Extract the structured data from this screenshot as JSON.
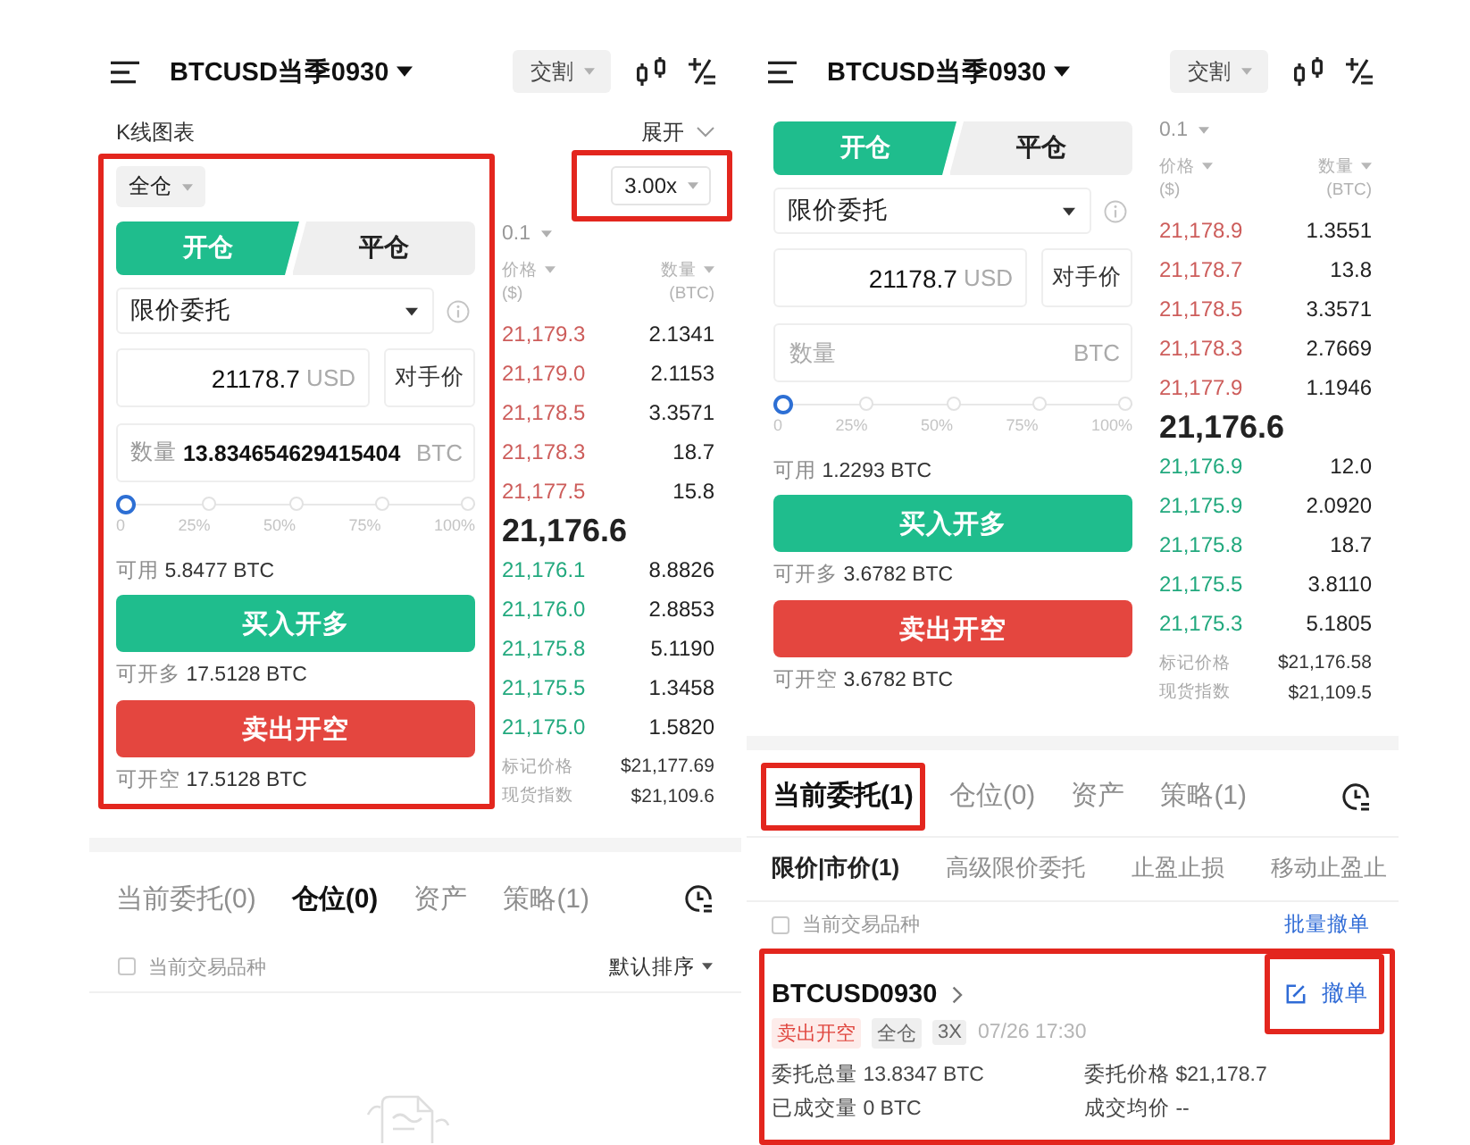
{
  "panels": [
    {
      "header": {
        "title": "BTCUSD当季0930",
        "contract_type": "交割"
      },
      "chart_bar": {
        "label": "K线图表",
        "toggle": "展开"
      },
      "form": {
        "highlighted": true,
        "margin_mode": "全仓",
        "tabs": [
          {
            "label": "开仓",
            "selected": true
          },
          {
            "label": "平仓",
            "selected": false
          }
        ],
        "order_type": "限价委托",
        "price": {
          "value": "21178.7",
          "unit": "USD"
        },
        "counter_price_button": "对手价",
        "quantity": {
          "label": "数量",
          "value": "13.834654629415404",
          "unit": "BTC"
        },
        "slider": {
          "level": 0,
          "ticks": [
            "0",
            "25%",
            "50%",
            "75%",
            "100%"
          ]
        },
        "available": {
          "label": "可用",
          "value": "5.8477 BTC"
        },
        "buy_button": "买入开多",
        "max_long": {
          "label": "可开多",
          "value": "17.5128 BTC"
        },
        "sell_button": "卖出开空",
        "max_short": {
          "label": "可开空",
          "value": "17.5128 BTC"
        }
      },
      "order_book": {
        "leverage": {
          "value": "3.00x",
          "highlighted": true
        },
        "precision": "0.1",
        "price_header": {
          "label": "价格",
          "unit": "($)"
        },
        "amount_header": {
          "label": "数量",
          "unit": "(BTC)"
        },
        "asks": [
          {
            "price": "21,179.3",
            "amount": "2.1341"
          },
          {
            "price": "21,179.0",
            "amount": "2.1153"
          },
          {
            "price": "21,178.5",
            "amount": "3.3571"
          },
          {
            "price": "21,178.3",
            "amount": "18.7"
          },
          {
            "price": "21,177.5",
            "amount": "15.8"
          }
        ],
        "last_price": "21,176.6",
        "bids": [
          {
            "price": "21,176.1",
            "amount": "8.8826"
          },
          {
            "price": "21,176.0",
            "amount": "2.8853"
          },
          {
            "price": "21,175.8",
            "amount": "5.1190"
          },
          {
            "price": "21,175.5",
            "amount": "1.3458"
          },
          {
            "price": "21,175.0",
            "amount": "1.5820"
          }
        ],
        "mark_price": {
          "label": "标记价格",
          "value": "$21,177.69"
        },
        "index_price": {
          "label": "现货指数",
          "value": "$21,109.6"
        }
      },
      "orders": {
        "tabs": [
          {
            "label": "当前委托(0)",
            "selected": false,
            "highlighted": false
          },
          {
            "label": "仓位(0)",
            "selected": true,
            "highlighted": false
          },
          {
            "label": "资产",
            "selected": false,
            "highlighted": false
          },
          {
            "label": "策略(1)",
            "selected": false,
            "highlighted": false
          }
        ],
        "filter": {
          "label": "当前交易品种",
          "checked": false
        },
        "sort": "默认排序"
      }
    },
    {
      "header": {
        "title": "BTCUSD当季0930",
        "contract_type": "交割"
      },
      "form": {
        "highlighted": false,
        "tabs": [
          {
            "label": "开仓",
            "selected": true
          },
          {
            "label": "平仓",
            "selected": false
          }
        ],
        "order_type": "限价委托",
        "price": {
          "value": "21178.7",
          "unit": "USD"
        },
        "counter_price_button": "对手价",
        "quantity": {
          "placeholder": "数量",
          "unit": "BTC"
        },
        "slider": {
          "level": 0,
          "ticks": [
            "0",
            "25%",
            "50%",
            "75%",
            "100%"
          ]
        },
        "available": {
          "label": "可用",
          "value": "1.2293 BTC"
        },
        "buy_button": "买入开多",
        "max_long": {
          "label": "可开多",
          "value": "3.6782 BTC"
        },
        "sell_button": "卖出开空",
        "max_short": {
          "label": "可开空",
          "value": "3.6782 BTC"
        }
      },
      "order_book": {
        "precision": "0.1",
        "price_header": {
          "label": "价格",
          "unit": "($)"
        },
        "amount_header": {
          "label": "数量",
          "unit": "(BTC)"
        },
        "asks": [
          {
            "price": "21,178.9",
            "amount": "1.3551"
          },
          {
            "price": "21,178.7",
            "amount": "13.8"
          },
          {
            "price": "21,178.5",
            "amount": "3.3571"
          },
          {
            "price": "21,178.3",
            "amount": "2.7669"
          },
          {
            "price": "21,177.9",
            "amount": "1.1946"
          }
        ],
        "last_price": "21,176.6",
        "bids": [
          {
            "price": "21,176.9",
            "amount": "12.0"
          },
          {
            "price": "21,175.9",
            "amount": "2.0920"
          },
          {
            "price": "21,175.8",
            "amount": "18.7"
          },
          {
            "price": "21,175.5",
            "amount": "3.8110"
          },
          {
            "price": "21,175.3",
            "amount": "5.1805"
          }
        ],
        "mark_price": {
          "label": "标记价格",
          "value": "$21,176.58"
        },
        "index_price": {
          "label": "现货指数",
          "value": "$21,109.5"
        }
      },
      "orders": {
        "tabs": [
          {
            "label": "当前委托(1)",
            "selected": true,
            "highlighted": true
          },
          {
            "label": "仓位(0)",
            "selected": false,
            "highlighted": false
          },
          {
            "label": "资产",
            "selected": false,
            "highlighted": false
          },
          {
            "label": "策略(1)",
            "selected": false,
            "highlighted": false
          }
        ],
        "sub_tabs": [
          {
            "label": "限价|市价(1)",
            "selected": true
          },
          {
            "label": "高级限价委托",
            "selected": false
          },
          {
            "label": "止盈止损",
            "selected": false
          },
          {
            "label": "移动止盈止",
            "selected": false
          }
        ],
        "filter": {
          "label": "当前交易品种",
          "checked": false
        },
        "batch_cancel": "批量撤单",
        "list": [
          {
            "highlighted": true,
            "symbol": "BTCUSD0930",
            "actions_highlighted": true,
            "cancel": "撤单",
            "tags": [
              {
                "label": "卖出开空",
                "kind": "side"
              },
              {
                "label": "全仓",
                "kind": "plain"
              },
              {
                "label": "3X",
                "kind": "plain"
              }
            ],
            "time": "07/26 17:30",
            "details": [
              "委托总量 13.8347 BTC",
              "委托价格 $21,178.7",
              "已成交量 0 BTC",
              "成交均价 --"
            ]
          }
        ]
      }
    }
  ]
}
